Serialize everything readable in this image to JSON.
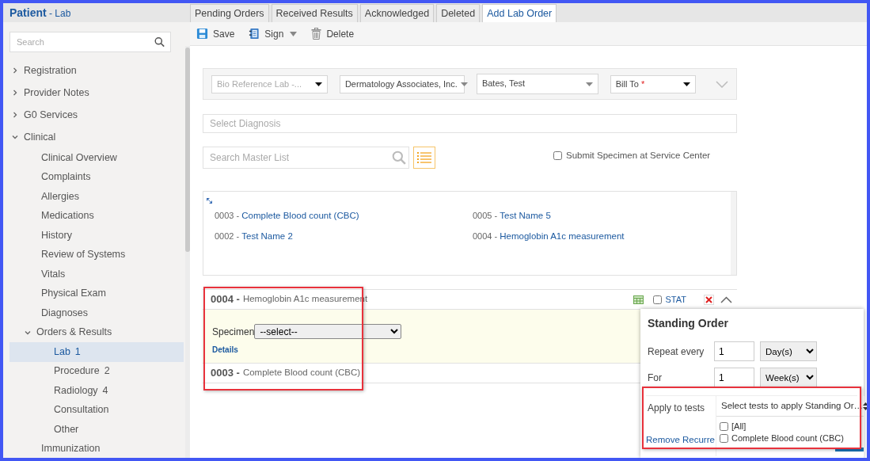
{
  "header": {
    "title": "Patient",
    "separator": "-",
    "subtitle": "Lab"
  },
  "sidebar": {
    "search": {
      "placeholder": "Search"
    },
    "items": [
      {
        "kind": "group",
        "label": "Registration",
        "expanded": false,
        "selected": false
      },
      {
        "kind": "group",
        "label": "Provider Notes",
        "expanded": false,
        "selected": false
      },
      {
        "kind": "group",
        "label": "G0 Services",
        "expanded": false,
        "selected": false
      },
      {
        "kind": "group",
        "label": "Clinical",
        "expanded": true,
        "selected": false,
        "children": [
          {
            "kind": "link",
            "label": "Clinical Overview",
            "selected": false
          },
          {
            "kind": "link",
            "label": "Complaints",
            "selected": false
          },
          {
            "kind": "link",
            "label": "Allergies",
            "selected": false
          },
          {
            "kind": "link",
            "label": "Medications",
            "selected": false
          },
          {
            "kind": "link",
            "label": "History",
            "selected": false
          },
          {
            "kind": "link",
            "label": "Review of Systems",
            "selected": false
          },
          {
            "kind": "link",
            "label": "Vitals",
            "selected": false
          },
          {
            "kind": "link",
            "label": "Physical Exam",
            "selected": false
          },
          {
            "kind": "link",
            "label": "Diagnoses",
            "selected": false
          },
          {
            "kind": "group",
            "label": "Orders & Results",
            "expanded": true,
            "selected": false,
            "children": [
              {
                "kind": "link",
                "label": "Lab",
                "count": "1",
                "selected": true
              },
              {
                "kind": "link",
                "label": "Procedure",
                "count": "2",
                "selected": false
              },
              {
                "kind": "link",
                "label": "Radiology",
                "count": "4",
                "selected": false
              },
              {
                "kind": "link",
                "label": "Consultation",
                "selected": false
              },
              {
                "kind": "link",
                "label": "Other",
                "selected": false
              }
            ]
          },
          {
            "kind": "link",
            "label": "Immunization",
            "selected": false
          }
        ]
      }
    ]
  },
  "tabs": [
    {
      "label": "Pending Orders",
      "selected": false
    },
    {
      "label": "Received Results",
      "selected": false
    },
    {
      "label": "Acknowledged",
      "selected": false
    },
    {
      "label": "Deleted",
      "selected": false
    },
    {
      "label": "Add Lab Order",
      "selected": true
    }
  ],
  "toolbar": [
    {
      "kind": "save",
      "label": "Save"
    },
    {
      "kind": "sign",
      "label": "Sign"
    },
    {
      "kind": "delete",
      "label": "Delete"
    }
  ],
  "filters": [
    {
      "kind": "placeholder",
      "text": "Bio Reference Lab -..."
    },
    {
      "kind": "value",
      "text": "Dermatology Associates, Inc."
    },
    {
      "kind": "value",
      "text": "Bates, Test"
    },
    {
      "kind": "required",
      "text": "Bill To",
      "required_mark": "*"
    }
  ],
  "diagnosis": {
    "placeholder": "Select Diagnosis"
  },
  "master_search": {
    "placeholder": "Search Master List"
  },
  "submit_specimen": {
    "label": "Submit Specimen at Service Center",
    "checked": false
  },
  "tests": [
    {
      "code": "0003 -",
      "name": "Complete Blood count (CBC)"
    },
    {
      "code": "0005 -",
      "name": "Test Name 5"
    },
    {
      "code": "0002 -",
      "name": "Test Name 2"
    },
    {
      "code": "0004 -",
      "name": "Hemoglobin A1c measurement"
    }
  ],
  "orders": [
    {
      "code": "0004 -",
      "name": "Hemoglobin A1c measurement",
      "expanded": true,
      "specimen_label": "Specimen",
      "specimen": "--select--",
      "details": "Details",
      "stat": {
        "label": "STAT",
        "checked": false
      }
    },
    {
      "code": "0003 -",
      "name": "Complete Blood count (CBC)",
      "expanded": false
    }
  ],
  "standing_order": {
    "title": "Standing Order",
    "rows": [
      {
        "label": "Repeat every",
        "value": "1",
        "unit": "Day(s)"
      },
      {
        "label": "For",
        "value": "1",
        "unit": "Week(s)"
      }
    ],
    "apply": {
      "label": "Apply to tests",
      "placeholder": "Select tests to apply Standing Or…",
      "options": [
        {
          "label": "[All]",
          "checked": false
        },
        {
          "label": "Complete Blood count (CBC)",
          "checked": false
        }
      ]
    },
    "remove_link": "Remove Recurre"
  }
}
